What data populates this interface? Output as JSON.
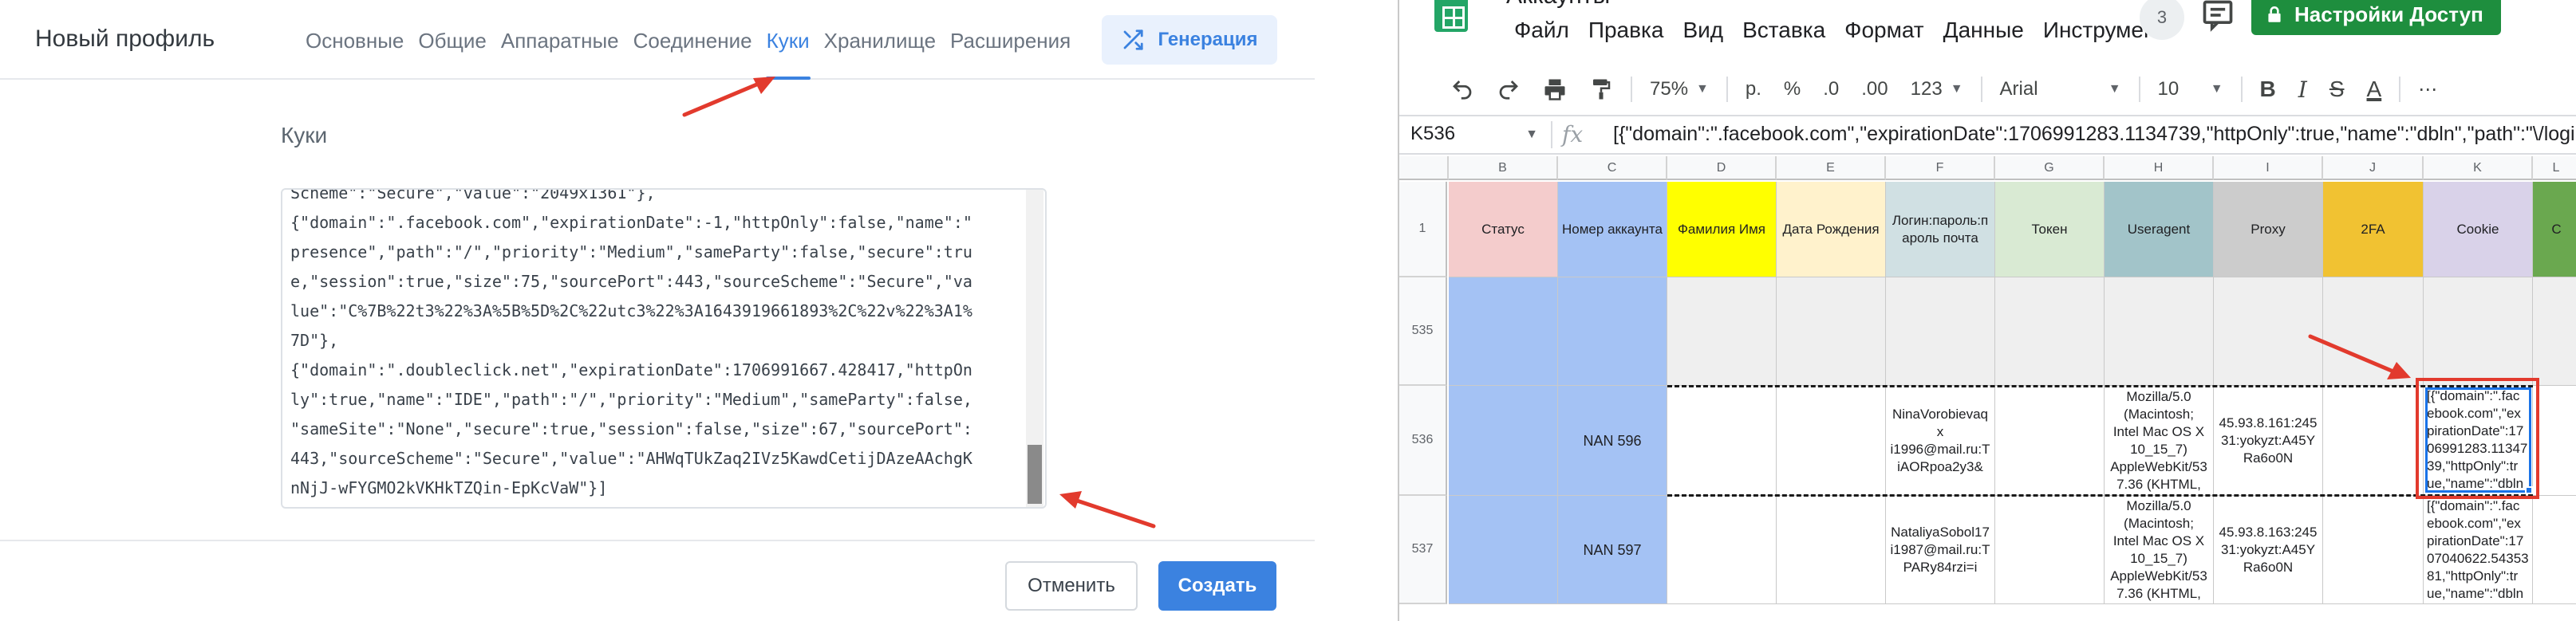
{
  "profile_editor": {
    "title": "Новый профиль",
    "tabs": [
      {
        "label": "Основные",
        "active": false
      },
      {
        "label": "Общие",
        "active": false
      },
      {
        "label": "Аппаратные",
        "active": false
      },
      {
        "label": "Соединение",
        "active": false
      },
      {
        "label": "Куки",
        "active": true
      },
      {
        "label": "Хранилище",
        "active": false
      },
      {
        "label": "Расширения",
        "active": false
      }
    ],
    "generate_label": "Генерация",
    "section_title": "Куки",
    "cookies_text": "Scheme\":\"Secure\",\"value\":\"2049x1361\"},\n{\"domain\":\".facebook.com\",\"expirationDate\":-1,\"httpOnly\":false,\"name\":\"\npresence\",\"path\":\"/\",\"priority\":\"Medium\",\"sameParty\":false,\"secure\":tru\ne,\"session\":true,\"size\":75,\"sourcePort\":443,\"sourceScheme\":\"Secure\",\"va\nlue\":\"C%7B%22t3%22%3A%5B%5D%2C%22utc3%22%3A1643919661893%2C%22v%22%3A1%\n7D\"},\n{\"domain\":\".doubleclick.net\",\"expirationDate\":1706991667.428417,\"httpOn\nly\":true,\"name\":\"IDE\",\"path\":\"/\",\"priority\":\"Medium\",\"sameParty\":false,\n\"sameSite\":\"None\",\"secure\":true,\"session\":false,\"size\":67,\"sourcePort\":\n443,\"sourceScheme\":\"Secure\",\"value\":\"AHWqTUkZaq2IVz5KawdCetijDAzeAAchgK\nnNjJ-wFYGMO2kVKHkTZQin-EpKcVaW\"}]",
    "cancel_label": "Отменить",
    "create_label": "Создать",
    "accent_color": "#3b82e0",
    "annotation_color": "#e23a2d"
  },
  "spreadsheet": {
    "doc_title": "Аккаунты",
    "menu": [
      "Файл",
      "Правка",
      "Вид",
      "Вставка",
      "Формат",
      "Данные",
      "Инструмент"
    ],
    "collaborators_count": "3",
    "share_label": "Настройки Доступ",
    "toolbar": {
      "zoom": "75%",
      "currency": "р.",
      "percent": "%",
      "decimal_less": ".0",
      "decimal_more": ".00",
      "number_format": "123",
      "font": "Arial",
      "font_size": "10",
      "bold": "B",
      "italic": "I",
      "strike": "S",
      "text_color": "A",
      "more": "⋯"
    },
    "name_box": "K536",
    "fx": "fx",
    "formula": "[{\"domain\":\".facebook.com\",\"expirationDate\":1706991283.1134739,\"httpOnly\":true,\"name\":\"dbln\",\"path\":\"\\/login\\/dev",
    "columns": [
      {
        "letter": "B",
        "header": "Статус",
        "color": "#f4cccc"
      },
      {
        "letter": "C",
        "header": "Номер аккаунта",
        "color": "#a4c2f4"
      },
      {
        "letter": "D",
        "header": "Фамилия Имя",
        "color": "#ffff00"
      },
      {
        "letter": "E",
        "header": "Дата Рождения",
        "color": "#fff2cc"
      },
      {
        "letter": "F",
        "header": "Логин:пароль:п\nароль почта",
        "color": "#d0e0e3"
      },
      {
        "letter": "G",
        "header": "Токен",
        "color": "#d9ead3"
      },
      {
        "letter": "H",
        "header": "Useragent",
        "color": "#a2c4c9"
      },
      {
        "letter": "I",
        "header": "Proxy",
        "color": "#cccccc"
      },
      {
        "letter": "J",
        "header": "2FA",
        "color": "#f1c232"
      },
      {
        "letter": "K",
        "header": "Cookie",
        "color": "#d9d2e9"
      },
      {
        "letter": "L",
        "header": "C",
        "color": "#6aa84f"
      }
    ],
    "rows": [
      {
        "num": "1",
        "cells": []
      },
      {
        "num": "535",
        "cells": [
          "",
          "",
          "",
          "",
          "",
          "",
          "",
          "",
          "",
          "",
          ""
        ]
      },
      {
        "num": "536",
        "cells": [
          "",
          "NAN 596",
          "",
          "",
          "NinaVorobievaqx\ni1996@mail.ru:T\niAORpoa2y3&",
          "",
          "Mozilla/5.0\n(Macintosh;\nIntel Mac OS X\n10_15_7)\nAppleWebKit/53\n7.36 (KHTML,",
          "45.93.8.161:245\n31:yokyzt:A45Y\nRa6o0N",
          "",
          "[{\"domain\":\".fac\nebook.com\",\"ex\npirationDate\":17\n06991283.11347\n39,\"httpOnly\":tr\nue,\"name\":\"dbln",
          ""
        ]
      },
      {
        "num": "537",
        "cells": [
          "",
          "NAN 597",
          "",
          "",
          "NataliyaSobol17\ni1987@mail.ru:T\nPARy84rzi=i",
          "",
          "Mozilla/5.0\n(Macintosh;\nIntel Mac OS X\n10_15_7)\nAppleWebKit/53\n7.36 (KHTML,",
          "45.93.8.163:245\n31:yokyzt:A45Y\nRa6o0N",
          "",
          "[{\"domain\":\".fac\nebook.com\",\"ex\npirationDate\":17\n07040622.54353\n81,\"httpOnly\":tr\nue,\"name\":\"dbln",
          ""
        ]
      }
    ]
  }
}
